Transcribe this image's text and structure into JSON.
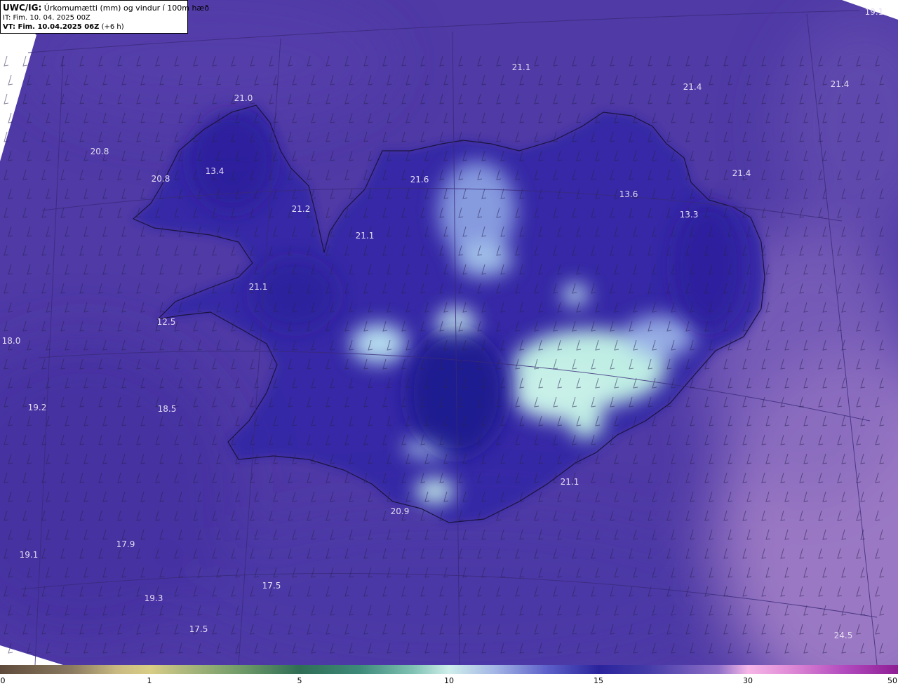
{
  "header": {
    "title_bold": "UWC/IG:",
    "title_rest": "Úrkomumætti (mm) og vindur í 100m hæð",
    "it_line": "IT: Fim. 10. 04. 2025 00Z",
    "vt_bold": "VT: Fim. 10.04.2025 06Z",
    "vt_rest": "(+6 h)"
  },
  "value_labels": [
    {
      "text": "21.0"
    },
    {
      "text": "20.8"
    },
    {
      "text": "13.4"
    },
    {
      "text": "20.8"
    },
    {
      "text": "21.2"
    },
    {
      "text": "21.1"
    },
    {
      "text": "21.6"
    },
    {
      "text": "21.1"
    },
    {
      "text": "21.4"
    },
    {
      "text": "21.4"
    },
    {
      "text": "19.1"
    },
    {
      "text": "13.6"
    },
    {
      "text": "13.3"
    },
    {
      "text": "21.4"
    },
    {
      "text": "21.1"
    },
    {
      "text": "12.5"
    },
    {
      "text": "18.0"
    },
    {
      "text": "19.2"
    },
    {
      "text": "18.5"
    },
    {
      "text": "21.1"
    },
    {
      "text": "20.9"
    },
    {
      "text": "17.9"
    },
    {
      "text": "19.1"
    },
    {
      "text": "17.5"
    },
    {
      "text": "19.3"
    },
    {
      "text": "17.5"
    },
    {
      "text": "24.5"
    }
  ],
  "colorbar": {
    "ticks": [
      {
        "label": "0",
        "value": 0
      },
      {
        "label": "1",
        "value": 1
      },
      {
        "label": "5",
        "value": 5
      },
      {
        "label": "10",
        "value": 10
      },
      {
        "label": "15",
        "value": 15
      },
      {
        "label": "30",
        "value": 30
      },
      {
        "label": "50",
        "value": 50
      }
    ]
  },
  "colors": {
    "ocean_base": "#5139a8",
    "land_base": "#3a2ea8",
    "heavy_precip": "#c8f0e8",
    "outlier_high": "#a882c8"
  }
}
